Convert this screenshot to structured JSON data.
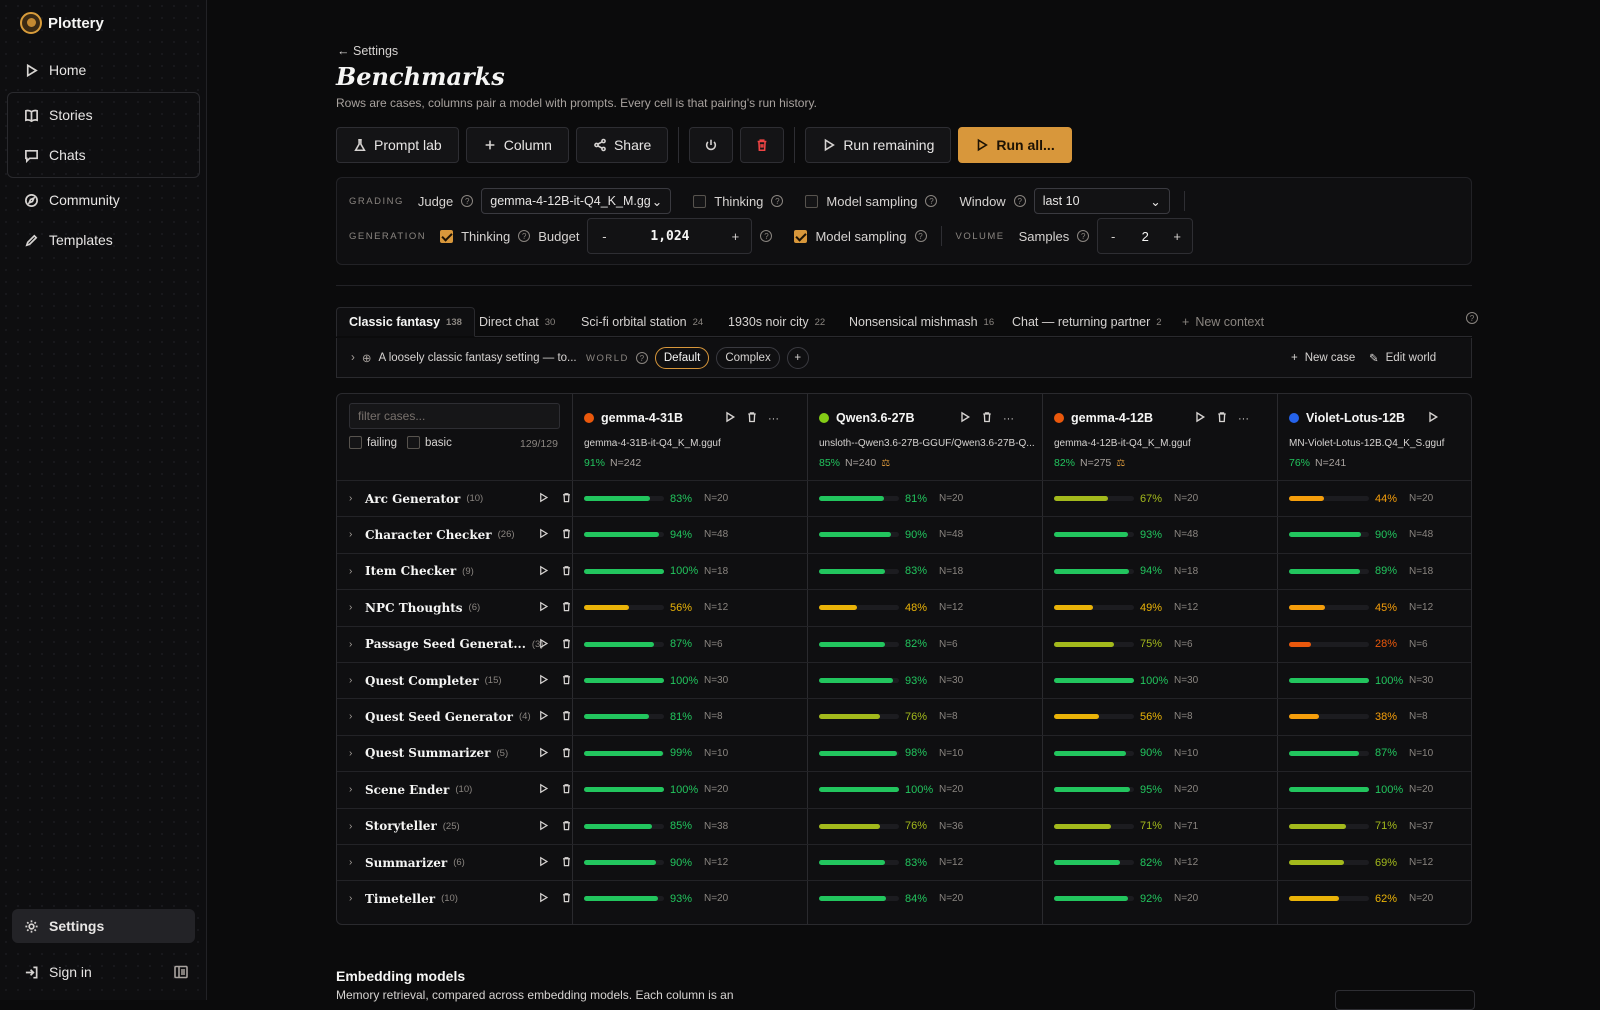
{
  "app": {
    "name": "Plottery"
  },
  "sidebar": {
    "items": [
      {
        "label": "Home",
        "icon": "play-icon"
      },
      {
        "label": "Stories",
        "icon": "book-icon"
      },
      {
        "label": "Chats",
        "icon": "chat-icon"
      },
      {
        "label": "Community",
        "icon": "compass-icon"
      },
      {
        "label": "Templates",
        "icon": "pen-icon"
      }
    ],
    "settings": "Settings",
    "sign_in": "Sign in"
  },
  "page": {
    "back": "Settings",
    "title": "Benchmarks",
    "subtitle": "Rows are cases, columns pair a model with prompts. Every cell is that pairing's run history."
  },
  "toolbar": {
    "prompt_lab": "Prompt lab",
    "column": "Column",
    "share": "Share",
    "run_remaining": "Run remaining",
    "run_all": "Run all..."
  },
  "grading": {
    "caption": "GRADING",
    "judge_label": "Judge",
    "judge_value": "gemma-4-12B-it-Q4_K_M.gguf",
    "thinking": "Thinking",
    "thinking_checked": false,
    "model_sampling": "Model sampling",
    "model_sampling_checked": false,
    "window_label": "Window",
    "window_value": "last 10"
  },
  "generation": {
    "caption": "GENERATION",
    "thinking": "Thinking",
    "thinking_checked": true,
    "budget_label": "Budget",
    "budget_value": "1,024",
    "model_sampling": "Model sampling",
    "model_sampling_checked": true
  },
  "volume": {
    "caption": "VOLUME",
    "samples_label": "Samples",
    "samples_value": "2"
  },
  "tabs": [
    {
      "label": "Classic fantasy",
      "count": "138"
    },
    {
      "label": "Direct chat",
      "count": "30"
    },
    {
      "label": "Sci-fi orbital station",
      "count": "24"
    },
    {
      "label": "1930s noir city",
      "count": "22"
    },
    {
      "label": "Nonsensical mishmash",
      "count": "16"
    },
    {
      "label": "Chat — returning partner",
      "count": "2"
    }
  ],
  "new_context": "New context",
  "context": {
    "description": "A loosely classic fantasy setting — to...",
    "world_caption": "WORLD",
    "world_options": [
      "Default",
      "Complex"
    ],
    "new_case": "New case",
    "edit_world": "Edit world"
  },
  "grid": {
    "filter_placeholder": "filter cases...",
    "failing": "failing",
    "basic": "basic",
    "count": "129/129",
    "models": [
      {
        "name": "gemma-4-31B",
        "file": "gemma-4-31B-it-Q4_K_M.gguf",
        "pct": "91%",
        "n": "N=242",
        "color": "#ea580c",
        "judge": false
      },
      {
        "name": "Qwen3.6-27B",
        "file": "unsloth--Qwen3.6-27B-GGUF/Qwen3.6-27B-Q...",
        "pct": "85%",
        "n": "N=240",
        "color": "#84cc16",
        "judge": true
      },
      {
        "name": "gemma-4-12B",
        "file": "gemma-4-12B-it-Q4_K_M.gguf",
        "pct": "82%",
        "n": "N=275",
        "color": "#ea580c",
        "judge": true
      },
      {
        "name": "Violet-Lotus-12B",
        "file": "MN-Violet-Lotus-12B.Q4_K_S.gguf",
        "pct": "76%",
        "n": "N=241",
        "color": "#2563eb",
        "judge": false
      }
    ],
    "rows": [
      {
        "name": "Arc Generator",
        "count": "(10)",
        "cells": [
          [
            83,
            "N=20"
          ],
          [
            81,
            "N=20"
          ],
          [
            67,
            "N=20"
          ],
          [
            44,
            "N=20"
          ]
        ]
      },
      {
        "name": "Character Checker",
        "count": "(26)",
        "cells": [
          [
            94,
            "N=48"
          ],
          [
            90,
            "N=48"
          ],
          [
            93,
            "N=48"
          ],
          [
            90,
            "N=48"
          ]
        ]
      },
      {
        "name": "Item Checker",
        "count": "(9)",
        "cells": [
          [
            100,
            "N=18"
          ],
          [
            83,
            "N=18"
          ],
          [
            94,
            "N=18"
          ],
          [
            89,
            "N=18"
          ]
        ]
      },
      {
        "name": "NPC Thoughts",
        "count": "(6)",
        "cells": [
          [
            56,
            "N=12"
          ],
          [
            48,
            "N=12"
          ],
          [
            49,
            "N=12"
          ],
          [
            45,
            "N=12"
          ]
        ]
      },
      {
        "name": "Passage Seed Generat...",
        "count": "(3)",
        "cells": [
          [
            87,
            "N=6"
          ],
          [
            82,
            "N=6"
          ],
          [
            75,
            "N=6"
          ],
          [
            28,
            "N=6"
          ]
        ]
      },
      {
        "name": "Quest Completer",
        "count": "(15)",
        "cells": [
          [
            100,
            "N=30"
          ],
          [
            93,
            "N=30"
          ],
          [
            100,
            "N=30"
          ],
          [
            100,
            "N=30"
          ]
        ]
      },
      {
        "name": "Quest Seed Generator",
        "count": "(4)",
        "cells": [
          [
            81,
            "N=8"
          ],
          [
            76,
            "N=8"
          ],
          [
            56,
            "N=8"
          ],
          [
            38,
            "N=8"
          ]
        ]
      },
      {
        "name": "Quest Summarizer",
        "count": "(5)",
        "cells": [
          [
            99,
            "N=10"
          ],
          [
            98,
            "N=10"
          ],
          [
            90,
            "N=10"
          ],
          [
            87,
            "N=10"
          ]
        ]
      },
      {
        "name": "Scene Ender",
        "count": "(10)",
        "cells": [
          [
            100,
            "N=20"
          ],
          [
            100,
            "N=20"
          ],
          [
            95,
            "N=20"
          ],
          [
            100,
            "N=20"
          ]
        ]
      },
      {
        "name": "Storyteller",
        "count": "(25)",
        "cells": [
          [
            85,
            "N=38"
          ],
          [
            76,
            "N=36"
          ],
          [
            71,
            "N=71"
          ],
          [
            71,
            "N=37"
          ]
        ]
      },
      {
        "name": "Summarizer",
        "count": "(6)",
        "cells": [
          [
            90,
            "N=12"
          ],
          [
            83,
            "N=12"
          ],
          [
            82,
            "N=12"
          ],
          [
            69,
            "N=12"
          ]
        ]
      },
      {
        "name": "Timeteller",
        "count": "(10)",
        "cells": [
          [
            93,
            "N=20"
          ],
          [
            84,
            "N=20"
          ],
          [
            92,
            "N=20"
          ],
          [
            62,
            "N=20"
          ]
        ]
      }
    ]
  },
  "embedding": {
    "title": "Embedding models",
    "subtitle": "Memory retrieval, compared across embedding models. Each column is an"
  },
  "colors": {
    "accent": "#d8973b",
    "good": "#22c55e",
    "ok": "#a3b91c",
    "mid": "#eab308",
    "warn": "#f59e0b",
    "bad": "#ea580c"
  }
}
